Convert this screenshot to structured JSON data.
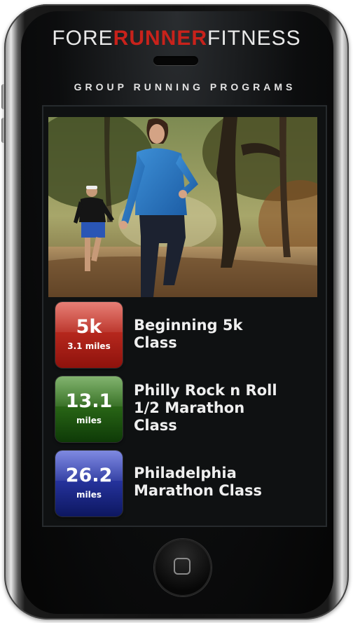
{
  "header": {
    "brand_left": "FORE",
    "brand_mid": "RUNNER",
    "brand_right": "FITNESS",
    "subtitle": "GROUP RUNNING PROGRAMS"
  },
  "programs": [
    {
      "badge_big": "5k",
      "badge_small": "3.1 miles",
      "title_lines": [
        "Beginning 5k",
        "Class"
      ],
      "badge_color": "#c8221b"
    },
    {
      "badge_big": "13.1",
      "badge_small": "miles",
      "title_lines": [
        "Philly Rock n Roll",
        "1/2 Marathon",
        "Class"
      ],
      "badge_color": "#1f5a12"
    },
    {
      "badge_big": "26.2",
      "badge_small": "miles",
      "title_lines": [
        "Philadelphia",
        "Marathon Class"
      ],
      "badge_color": "#1c2a8a"
    }
  ],
  "colors": {
    "brand_red": "#c8221b",
    "screen_bg": "#0f1112"
  }
}
